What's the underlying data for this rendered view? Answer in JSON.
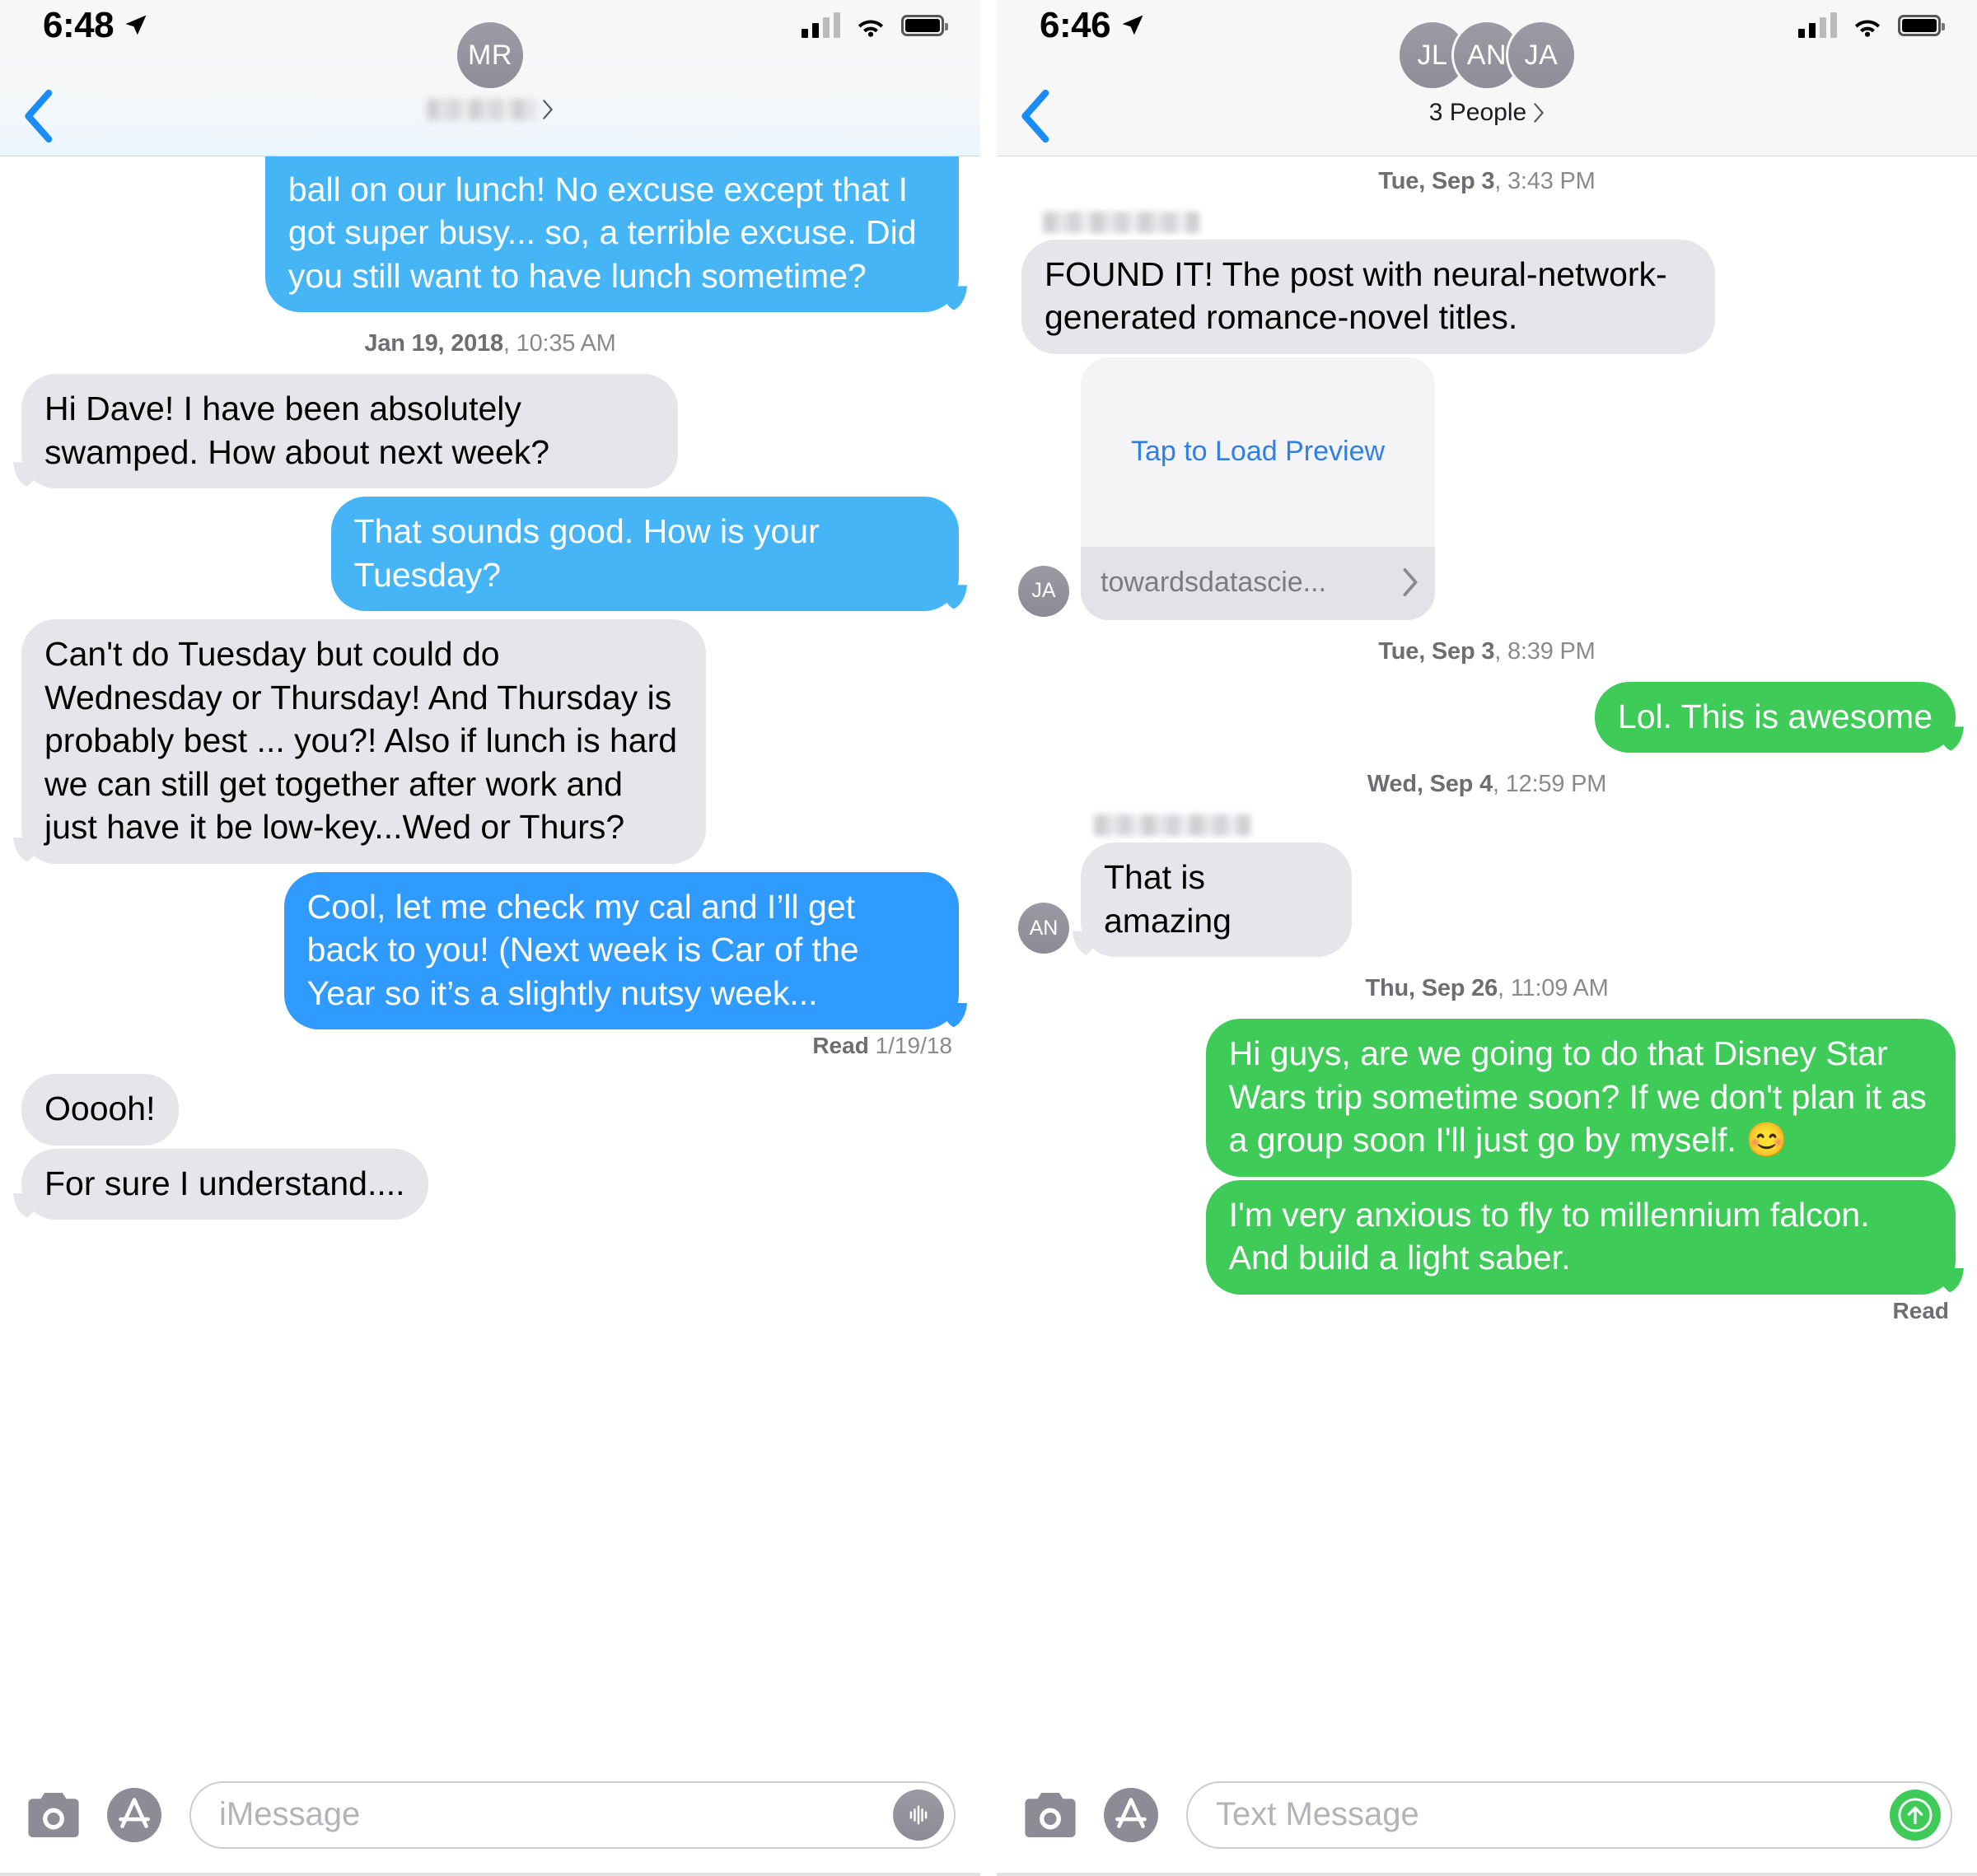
{
  "left": {
    "status": {
      "time": "6:48",
      "location_icon": "location-arrow-icon",
      "signal_icon": "cellular-signal-icon",
      "wifi_icon": "wifi-icon",
      "battery_icon": "battery-full-icon"
    },
    "nav": {
      "back_icon": "chevron-left-icon",
      "avatar_initials": "MR",
      "contact_name_redacted": "",
      "disclosure_icon": "chevron-right-icon"
    },
    "messages": [
      {
        "kind": "bubble",
        "side": "out",
        "style": "blue-light",
        "text": "ball on our lunch! No excuse except that I got super busy... so, a terrible excuse. Did you still want to have lunch sometime?"
      },
      {
        "kind": "timestamp",
        "date": "Jan 19, 2018",
        "time": ", 10:35 AM"
      },
      {
        "kind": "bubble",
        "side": "in",
        "style": "gray",
        "text": "Hi Dave! I have been absolutely swamped. How about next week?"
      },
      {
        "kind": "bubble",
        "side": "out",
        "style": "blue-light",
        "text": "That sounds good. How is your Tuesday?"
      },
      {
        "kind": "bubble",
        "side": "in",
        "style": "gray",
        "text": "Can't do Tuesday but could do Wednesday or Thursday! And Thursday is probably best ... you?! Also if lunch is hard we can still get together after work and just have it be low-key...Wed or Thurs?"
      },
      {
        "kind": "bubble",
        "side": "out",
        "style": "blue",
        "text": "Cool, let me check my cal and I’ll get back to you! (Next week is Car of the Year so it’s a slightly nutsy week..."
      },
      {
        "kind": "receipt",
        "label": "Read",
        "value": " 1/19/18"
      },
      {
        "kind": "bubble",
        "side": "in",
        "style": "gray",
        "text": "Ooooh!"
      },
      {
        "kind": "bubble",
        "side": "in",
        "style": "gray",
        "text": "For sure I understand...."
      }
    ],
    "composer": {
      "camera_icon": "camera-icon",
      "appstore_icon": "app-store-icon",
      "placeholder": "iMessage",
      "trailing_icon": "audio-waveform-icon"
    }
  },
  "right": {
    "status": {
      "time": "6:46",
      "location_icon": "location-arrow-icon",
      "signal_icon": "cellular-signal-icon",
      "wifi_icon": "wifi-icon",
      "battery_icon": "battery-full-icon"
    },
    "nav": {
      "back_icon": "chevron-left-icon",
      "avatars": [
        "JL",
        "AN",
        "JA"
      ],
      "group_label": "3 People",
      "disclosure_icon": "chevron-right-icon"
    },
    "messages": [
      {
        "kind": "timestamp",
        "date": "Tue, Sep 3",
        "time": ", 3:43 PM"
      },
      {
        "kind": "sender_redacted"
      },
      {
        "kind": "bubble",
        "side": "in",
        "style": "gray",
        "text": "FOUND IT! The post with neural-network-generated romance-novel titles."
      },
      {
        "kind": "preview",
        "side": "in",
        "avatar": "JA",
        "load_label": "Tap to Load Preview",
        "url": "towardsdatascie...",
        "chevron_icon": "chevron-right-icon"
      },
      {
        "kind": "timestamp",
        "date": "Tue, Sep 3",
        "time": ", 8:39 PM"
      },
      {
        "kind": "bubble",
        "side": "out",
        "style": "green",
        "text": "Lol. This is awesome"
      },
      {
        "kind": "timestamp",
        "date": "Wed, Sep 4",
        "time": ", 12:59 PM"
      },
      {
        "kind": "sender_redacted"
      },
      {
        "kind": "bubble",
        "side": "in",
        "style": "gray",
        "avatar": "AN",
        "text": "That is amazing"
      },
      {
        "kind": "timestamp",
        "date": "Thu, Sep 26",
        "time": ", 11:09 AM"
      },
      {
        "kind": "bubble",
        "side": "out",
        "style": "green",
        "text": "Hi guys, are we going to do that Disney Star Wars trip sometime soon? If we don't plan it as a group soon I'll just go by myself. 😊"
      },
      {
        "kind": "bubble",
        "side": "out",
        "style": "green",
        "text": "I'm very anxious to fly to millennium falcon. And build a light saber."
      },
      {
        "kind": "receipt",
        "label": "Read",
        "value": ""
      }
    ],
    "composer": {
      "camera_icon": "camera-icon",
      "appstore_icon": "app-store-icon",
      "placeholder": "Text Message",
      "trailing_icon": "send-arrow-up-icon"
    }
  },
  "colors": {
    "imessage_blue": "#2f9bff",
    "imessage_blue_light": "#46b5f5",
    "sms_green": "#3fcb58",
    "bubble_gray": "#e6e5ea",
    "link_blue": "#2f7fe8",
    "timestamp_gray": "#8a8a8e"
  }
}
